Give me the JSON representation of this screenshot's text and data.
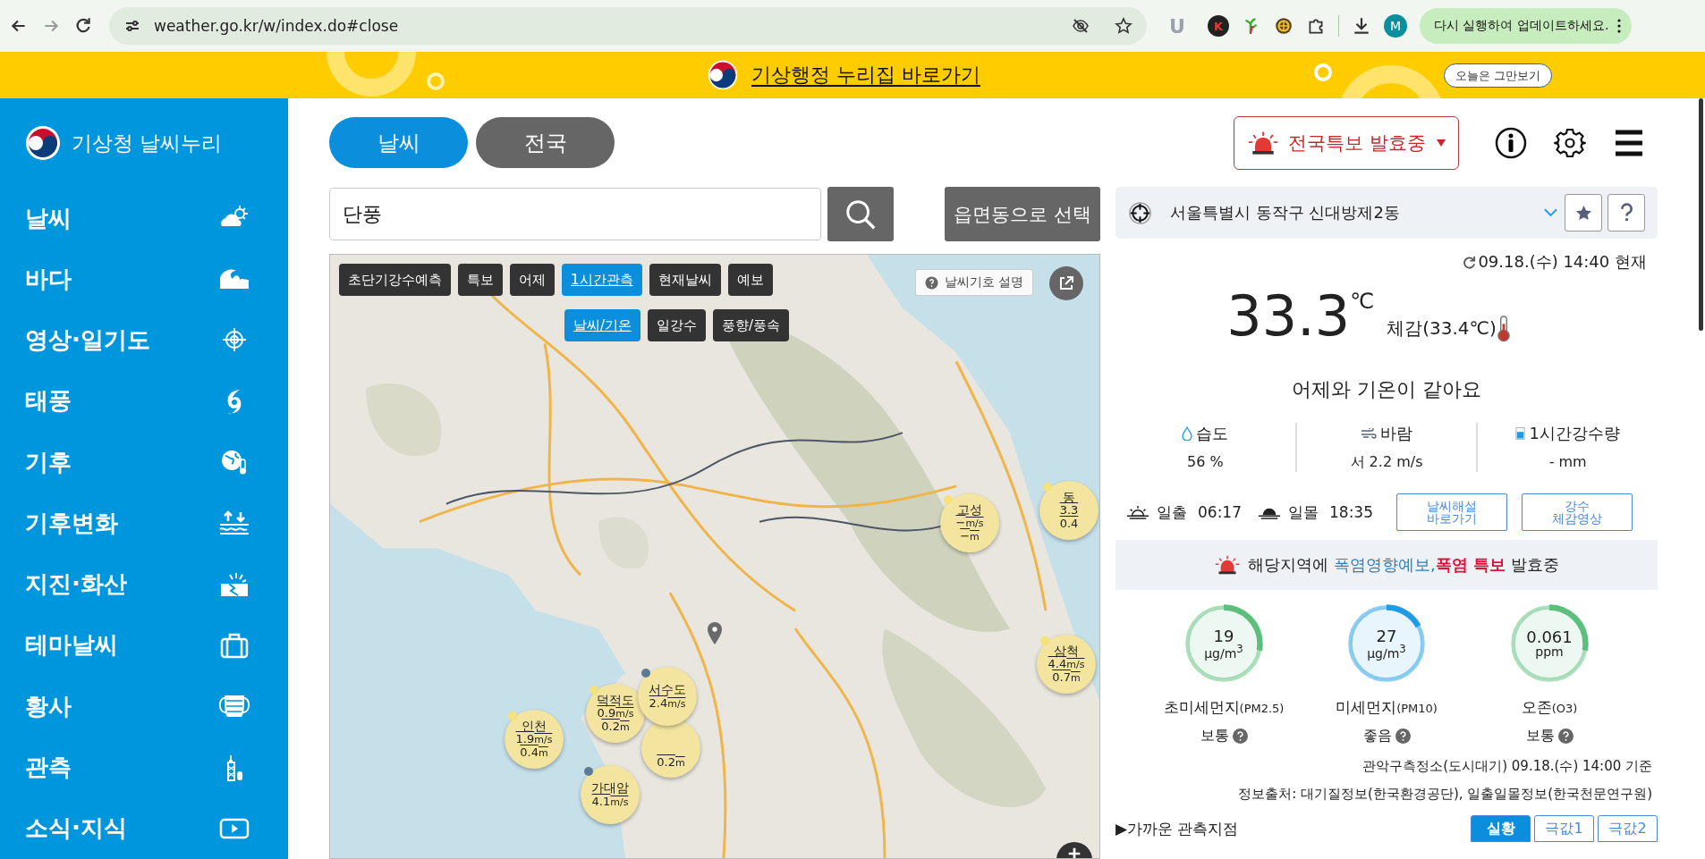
{
  "browser": {
    "url": "weather.go.kr/w/index.do#close",
    "extensions": [
      "U",
      "K"
    ],
    "profile": "M",
    "update_button": "다시 실행하여 업데이트하세요."
  },
  "banner": {
    "link": "기상행정 누리집 바로가기",
    "dismiss": "오늘은 그만보기"
  },
  "sidebar": {
    "logo": "기상청 날씨누리",
    "items": [
      {
        "label": "날씨"
      },
      {
        "label": "바다"
      },
      {
        "label": "영상·일기도"
      },
      {
        "label": "태풍"
      },
      {
        "label": "기후"
      },
      {
        "label": "기후변화"
      },
      {
        "label": "지진·화산"
      },
      {
        "label": "테마날씨"
      },
      {
        "label": "황사"
      },
      {
        "label": "관측"
      },
      {
        "label": "소식·지식"
      }
    ]
  },
  "top_tabs": [
    {
      "label": "날씨",
      "selected": true
    },
    {
      "label": "전국",
      "selected": false
    }
  ],
  "search": {
    "value": "단풍",
    "region_button": "읍면동으로 선택"
  },
  "map": {
    "tabs": [
      {
        "label": "초단기강수예측",
        "selected": false
      },
      {
        "label": "특보",
        "selected": false
      },
      {
        "label": "어제",
        "selected": false
      },
      {
        "label": "1시간관측",
        "selected": true
      },
      {
        "label": "현재날씨",
        "selected": false
      },
      {
        "label": "예보",
        "selected": false
      }
    ],
    "subtabs": [
      {
        "label": "날씨/기온",
        "selected": true
      },
      {
        "label": "일강수",
        "selected": false
      },
      {
        "label": "풍향/풍속",
        "selected": false
      }
    ],
    "legend_button": "날씨기호 설명",
    "stations": [
      {
        "name": "고성",
        "wind": "−",
        "wind_unit": "m/s",
        "wave": "−",
        "wave_unit": "m",
        "color": "#f5e27a"
      },
      {
        "name": "동",
        "wind": "3.3",
        "wave": "0.4",
        "color": "#f5e27a"
      },
      {
        "name": "삼척",
        "wind": "4.4",
        "wind_unit": "m/s",
        "wave": "0.7",
        "wave_unit": "m",
        "color": "#f5e27a"
      },
      {
        "name": "인천",
        "wind": "1.9",
        "wind_unit": "m/s",
        "wave": "0.4",
        "wave_unit": "m",
        "color": "#f5e27a"
      },
      {
        "name": "덕적도",
        "wind": "0.9",
        "wind_unit": "m/s",
        "wave": "0.2",
        "wave_unit": "m",
        "color": "#f5e27a"
      },
      {
        "name": "서수도",
        "wind": "2.4",
        "wind_unit": "m/s",
        "color": "#5b7c94"
      },
      {
        "wave": "0.2",
        "wave_unit": "m"
      },
      {
        "name": "가대암",
        "wind": "4.1",
        "wind_unit": "m/s",
        "color": "#5b7c94"
      }
    ]
  },
  "warning_button": "전국특보 발효중",
  "location": "서울특별시 동작구 신대방제2동",
  "observed_at": "09.18.(수) 14:40 현재",
  "temperature": {
    "value": "33.3",
    "unit": "℃",
    "feels_like": "체감(33.4℃)"
  },
  "comparison": "어제와 기온이 같아요",
  "stats": [
    {
      "label": "습도",
      "value": "56 %"
    },
    {
      "label": "바람",
      "value": "서 2.2 m/s"
    },
    {
      "label": "1시간강수량",
      "value": "- mm"
    }
  ],
  "sun": [
    {
      "label": "일출",
      "time": "06:17"
    },
    {
      "label": "일몰",
      "time": "18:35"
    }
  ],
  "link_buttons": [
    "날씨해설\n바로가기",
    "강수\n체감영상"
  ],
  "alert": [
    {
      "text": "해당지역에 ",
      "kind": "plain"
    },
    {
      "text": "폭염영향예보,",
      "kind": "link"
    },
    {
      "text": "폭염 특보",
      "kind": "warning"
    },
    {
      "text": " 발효중",
      "kind": "plain"
    }
  ],
  "air": [
    {
      "value": "19",
      "unit": "μg/m$^{3}$",
      "label": "초미세먼지",
      "code": "(PM2.5)",
      "grade": "보통",
      "level": 0.28,
      "color": "#5cbf7c"
    },
    {
      "value": "27",
      "unit": "μg/m$^{3}$",
      "label": "미세먼지",
      "code": "(PM10)",
      "grade": "좋음",
      "level": 0.17,
      "color": "#1e9be6"
    },
    {
      "value": "0.061",
      "unit": "ppm",
      "label": "오존",
      "code": "(O3)",
      "grade": "보통",
      "level": 0.28,
      "color": "#5cbf7c"
    }
  ],
  "air_station": "관악구측정소(도시대기) 09.18.(수) 14:00 기준",
  "source": "정보출처: 대기질정보(한국환경공단), 일출일몰정보(한국천문연구원)",
  "nearby": {
    "title": "▶가까운 관측지점",
    "tabs": [
      {
        "label": "실황",
        "selected": true
      },
      {
        "label": "극값1",
        "selected": false
      },
      {
        "label": "극값2",
        "selected": false
      }
    ]
  }
}
